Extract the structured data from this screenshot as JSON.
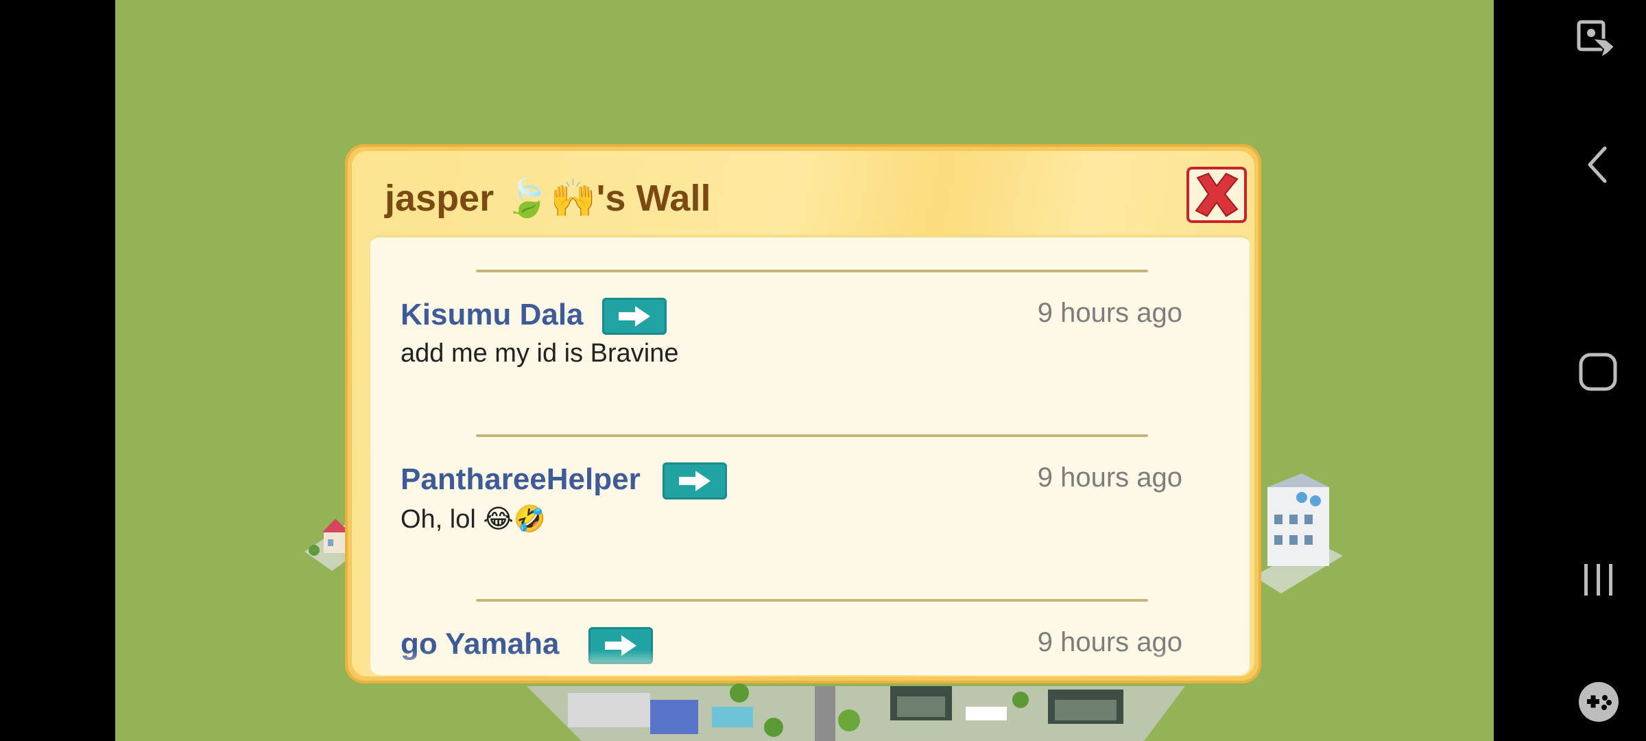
{
  "wall": {
    "title": "jasper 🍃🙌's Wall"
  },
  "posts": [
    {
      "name": "Kisumu Dala",
      "time": "9 hours ago",
      "text": "add me my id is Bravine"
    },
    {
      "name": "PanthareeHelper",
      "time": "9 hours ago",
      "text": "Oh, lol 😂🤣"
    },
    {
      "name": "go Yamaha",
      "time": "9 hours ago",
      "text": ""
    }
  ],
  "icons": {
    "close": "close-x-icon",
    "visit": "arrow-right-icon",
    "nav": [
      "screen-touch-icon",
      "back-icon",
      "home-icon",
      "recent-apps-icon",
      "game-tools-icon"
    ]
  },
  "colors": {
    "ground": "#94b356",
    "panel": "#f5c95e",
    "name": "#3e5b98",
    "visit_button": "#22a3a3",
    "close_red": "#c8232a"
  }
}
